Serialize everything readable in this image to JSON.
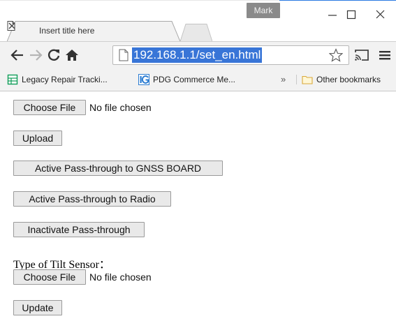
{
  "window": {
    "profile_name": "Mark"
  },
  "tab": {
    "title": "Insert title here"
  },
  "toolbar": {
    "url": "192.168.1.1/set_en.html"
  },
  "bookmarks": {
    "items": [
      {
        "label": "Legacy Repair Tracki...",
        "icon": "sheet-icon"
      },
      {
        "label": "PDG Commerce Me...",
        "icon": "ig-icon"
      }
    ],
    "overflow": "»",
    "other_label": "Other bookmarks"
  },
  "page": {
    "file1": {
      "button": "Choose File",
      "status": "No file chosen"
    },
    "upload_button": "Upload",
    "gnss_button": "Active Pass-through to GNSS BOARD",
    "radio_button": "Active Pass-through to Radio",
    "inactivate_button": "Inactivate Pass-through",
    "tilt_label": "Type of Tilt Sensor：",
    "file2": {
      "button": "Choose File",
      "status": "No file chosen"
    },
    "update_button": "Update"
  },
  "colors": {
    "selection": "#3875d7",
    "toolbar_bg": "#f2f2f2",
    "button_bg": "#e9e9e9"
  }
}
